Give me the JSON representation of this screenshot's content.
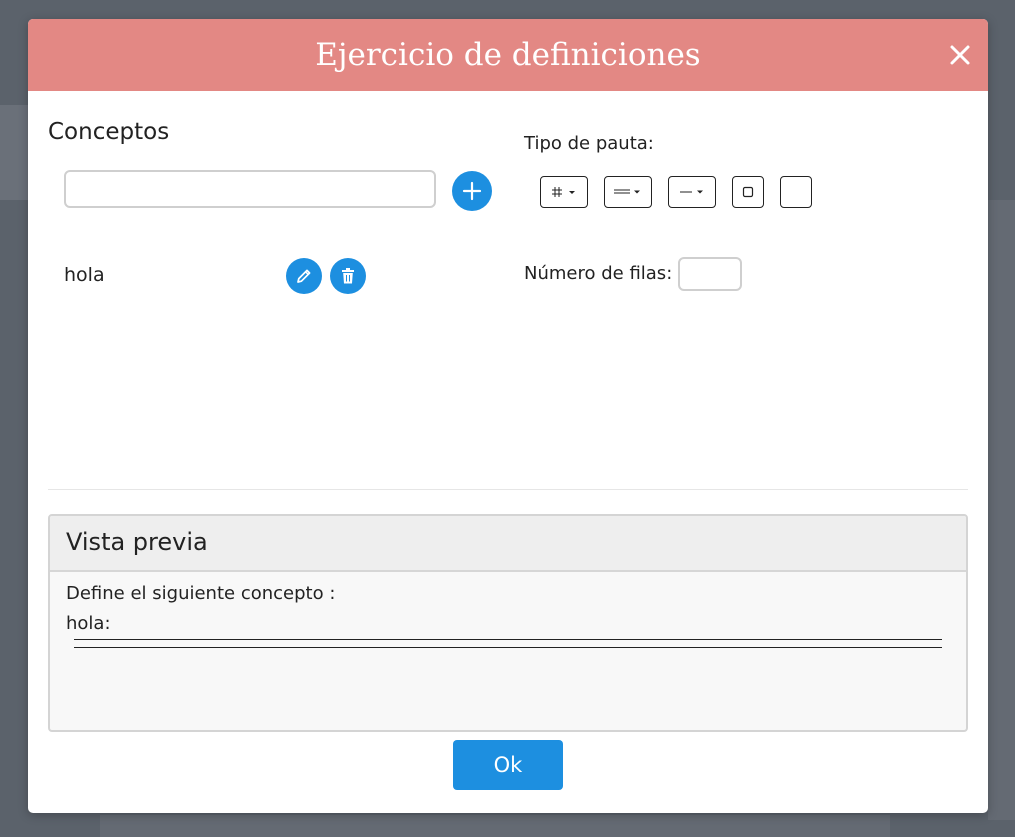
{
  "dialog": {
    "title": "Ejercicio de definiciones"
  },
  "concepts": {
    "heading": "Conceptos",
    "input_value": "",
    "items": [
      {
        "label": "hola"
      }
    ]
  },
  "pauta": {
    "label": "Tipo de pauta:",
    "options": [
      "grid",
      "double-line",
      "single-line",
      "square",
      "blank"
    ]
  },
  "rows": {
    "label": "Número de filas:",
    "value": ""
  },
  "preview": {
    "title": "Vista previa",
    "instruction": "Define el siguiente concepto :",
    "concept_line": "hola:"
  },
  "footer": {
    "ok_label": "Ok"
  },
  "colors": {
    "header": "#e38884",
    "accent": "#1d8fe0"
  },
  "icons": {
    "close": "close-icon",
    "add": "plus-icon",
    "edit": "pencil-icon",
    "delete": "trash-icon"
  }
}
